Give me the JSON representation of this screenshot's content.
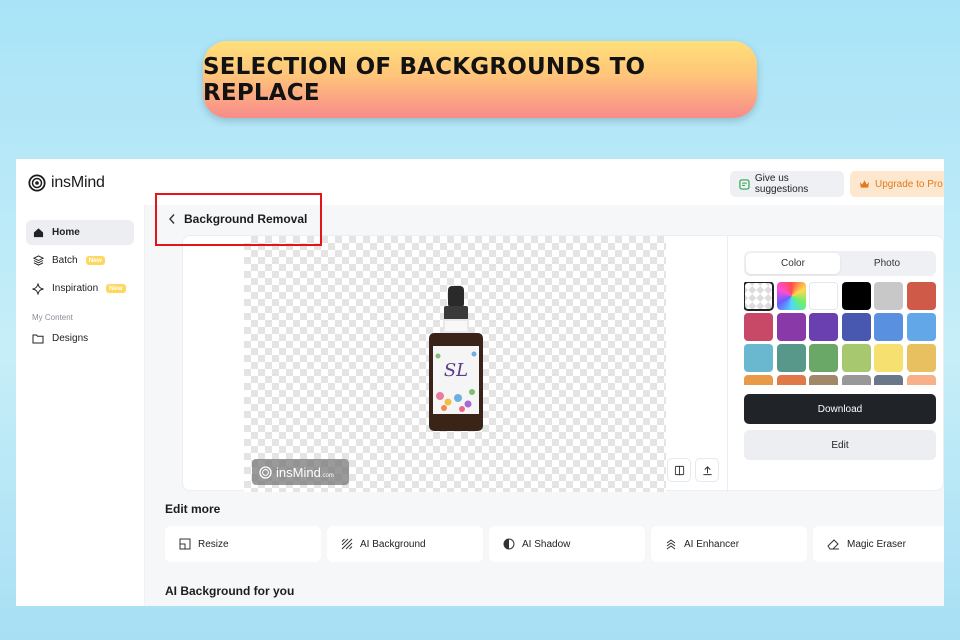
{
  "banner": {
    "text": "SELECTION OF BACKGROUNDS TO REPLACE"
  },
  "app": {
    "logo_text": "insMind",
    "suggestions_label": "Give us suggestions",
    "upgrade_label": "Upgrade to Pro"
  },
  "sidebar": {
    "items": [
      {
        "label": "Home",
        "icon": "home-icon",
        "active": true
      },
      {
        "label": "Batch",
        "icon": "layers-icon",
        "badge": "New"
      },
      {
        "label": "Inspiration",
        "icon": "sparkle-icon",
        "badge": "New"
      }
    ],
    "section_label": "My Content",
    "designs_label": "Designs"
  },
  "main": {
    "page_title": "Background Removal",
    "watermark_text": "insMind",
    "watermark_suffix": ".com",
    "product_label": "SL",
    "panel": {
      "tabs": [
        "Color",
        "Photo"
      ],
      "active_tab": "Color",
      "swatch_colors": [
        "transparent",
        "gradient",
        "#ffffff",
        "#000000",
        "#c8c8c8",
        "#d05a48",
        "#c84868",
        "#8a3aa8",
        "#6a40b0",
        "#4858b0",
        "#5a90e0",
        "#62a8e8",
        "#6ab8d0",
        "#58988a",
        "#6aa868",
        "#a8c870",
        "#f5e070",
        "#e8c060",
        "#e89a48",
        "#e07848",
        "#a08868",
        "#989898",
        "#687888",
        "#f8b088"
      ],
      "download_label": "Download",
      "edit_label": "Edit"
    },
    "edit_more_heading": "Edit more",
    "tools": [
      {
        "label": "Resize",
        "icon": "resize-icon"
      },
      {
        "label": "AI Background",
        "icon": "ai-background-icon"
      },
      {
        "label": "AI Shadow",
        "icon": "shadow-icon"
      },
      {
        "label": "AI Enhancer",
        "icon": "enhancer-icon"
      },
      {
        "label": "Magic Eraser",
        "icon": "eraser-icon"
      }
    ],
    "ai_background_heading": "AI Background for you"
  },
  "colors": {
    "accent_red": "#e5141b",
    "download_bg": "#202327",
    "upgrade_text": "#e07a20",
    "new_badge": "#ffd75e"
  }
}
